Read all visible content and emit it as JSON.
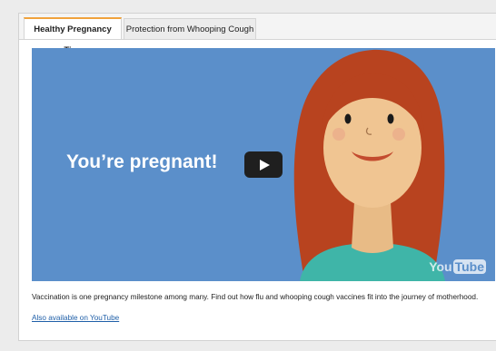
{
  "tabs": [
    {
      "label": "Healthy Pregnancy Tips",
      "active": true
    },
    {
      "label": "Protection from Whooping Cough",
      "active": false
    }
  ],
  "video": {
    "headline": "You’re pregnant!",
    "play_icon": "play-icon",
    "watermark_you": "You",
    "watermark_tube": "Tube",
    "background_color": "#5b8fca"
  },
  "description": "Vaccination is one pregnancy milestone among many. Find out how flu and whooping cough vaccines fit into the journey of motherhood.",
  "youtube_link": "Also available on YouTube",
  "colors": {
    "accent_tab": "#f0a23c",
    "link": "#1f5fa8"
  }
}
